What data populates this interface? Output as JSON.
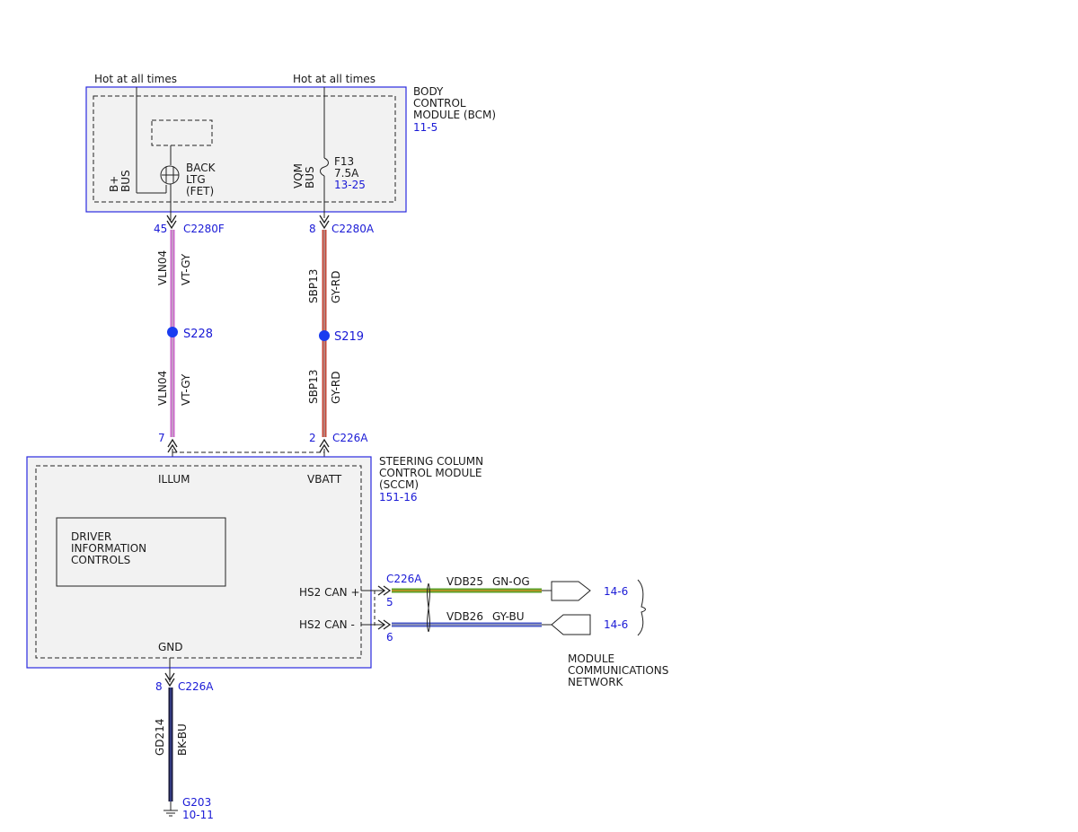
{
  "power": {
    "left_label": "Hot at all times",
    "right_label": "Hot at all times"
  },
  "bcm": {
    "name_lines": [
      "BODY",
      "CONTROL",
      "MODULE (BCM)"
    ],
    "ref": "11-5",
    "bplus_bus": [
      "B+",
      "BUS"
    ],
    "vqm_bus": [
      "VQM",
      "BUS"
    ],
    "fet_label": [
      "BACK",
      "LTG",
      "(FET)"
    ],
    "fuse_lines": [
      "F13",
      "7.5A"
    ],
    "fuse_ref": "13-25"
  },
  "connectors": {
    "left_top": {
      "pin": "45",
      "name": "C2280F"
    },
    "right_top": {
      "pin": "8",
      "name": "C2280A"
    },
    "left_bottom": {
      "pin": "7"
    },
    "right_bottom": {
      "pin": "2",
      "name": "C226A"
    },
    "gnd": {
      "pin": "8",
      "name": "C226A"
    },
    "can": {
      "name": "C226A",
      "pin_plus": "5",
      "pin_minus": "6"
    }
  },
  "wires": {
    "vln04": {
      "circuit": "VLN04",
      "color": "VT-GY"
    },
    "sbp13": {
      "circuit": "SBP13",
      "color": "GY-RD"
    },
    "gd214": {
      "circuit": "GD214",
      "color": "BK-BU"
    },
    "vdb25": {
      "circuit": "VDB25",
      "color": "GN-OG"
    },
    "vdb26": {
      "circuit": "VDB26",
      "color": "GY-BU"
    }
  },
  "splices": {
    "left": "S228",
    "right": "S219"
  },
  "sccm": {
    "name_lines": [
      "STEERING COLUMN",
      "CONTROL MODULE",
      "(SCCM)"
    ],
    "ref": "151-16",
    "pin_illum": "ILLUM",
    "pin_vbatt": "VBATT",
    "pin_gnd": "GND",
    "can_plus": "HS2 CAN +",
    "can_minus": "HS2 CAN -",
    "inner_box": [
      "DRIVER",
      "INFORMATION",
      "CONTROLS"
    ]
  },
  "network": {
    "ref_plus": "14-6",
    "ref_minus": "14-6",
    "label_lines": [
      "MODULE",
      "COMMUNICATIONS",
      "NETWORK"
    ]
  },
  "ground": {
    "name": "G203",
    "ref": "10-11"
  },
  "colors": {
    "module_border": "#2a2ae0",
    "module_fill": "#f2f2f2",
    "ref_text": "#1a1ad6",
    "splice": "#1a3cf0",
    "violet": "#cc66cc",
    "gray": "#b0b0b0",
    "red": "#c84a3a",
    "green": "#5aa02a",
    "orange": "#e08a20",
    "blue": "#4a5ac8",
    "black": "#1a1a1a"
  }
}
